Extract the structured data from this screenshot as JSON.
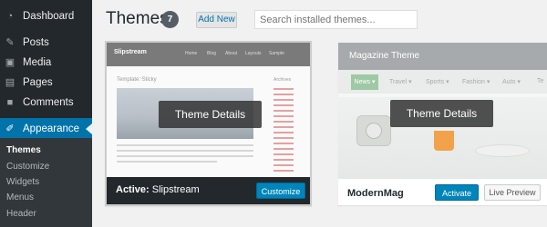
{
  "sidebar": {
    "items": [
      {
        "label": "Dashboard",
        "icon": "dashboard-icon",
        "glyph": "◔"
      },
      {
        "label": "Posts",
        "icon": "pin-icon",
        "glyph": "✎"
      },
      {
        "label": "Media",
        "icon": "media-icon",
        "glyph": "▣"
      },
      {
        "label": "Pages",
        "icon": "pages-icon",
        "glyph": "▤"
      },
      {
        "label": "Comments",
        "icon": "comments-icon",
        "glyph": "■"
      },
      {
        "label": "Appearance",
        "icon": "appearance-icon",
        "glyph": "✐"
      }
    ],
    "submenu": [
      "Themes",
      "Customize",
      "Widgets",
      "Menus",
      "Header"
    ]
  },
  "header": {
    "title": "Themes",
    "count": "7",
    "add_new": "Add New",
    "search_placeholder": "Search installed themes..."
  },
  "themes": [
    {
      "name": "Slipstream",
      "active_prefix": "Active:",
      "overlay": "Theme Details",
      "button": "Customize",
      "screenshot": {
        "logo": "Slipstream",
        "post_title": "Template: Sticky",
        "sidebar_title": "Archives"
      }
    },
    {
      "name": "ModernMag",
      "overlay": "Theme Details",
      "activate": "Activate",
      "preview": "Live Preview",
      "screenshot": {
        "title": "Magazine Theme",
        "nav": [
          "News ▾",
          "Travel ▾",
          "Sports ▾",
          "Fashion ▾",
          "Auto ▾",
          "Te"
        ]
      }
    }
  ],
  "colors": {
    "sidebar_bg": "#23282d",
    "accent": "#0073aa",
    "button_blue": "#0085ba"
  }
}
